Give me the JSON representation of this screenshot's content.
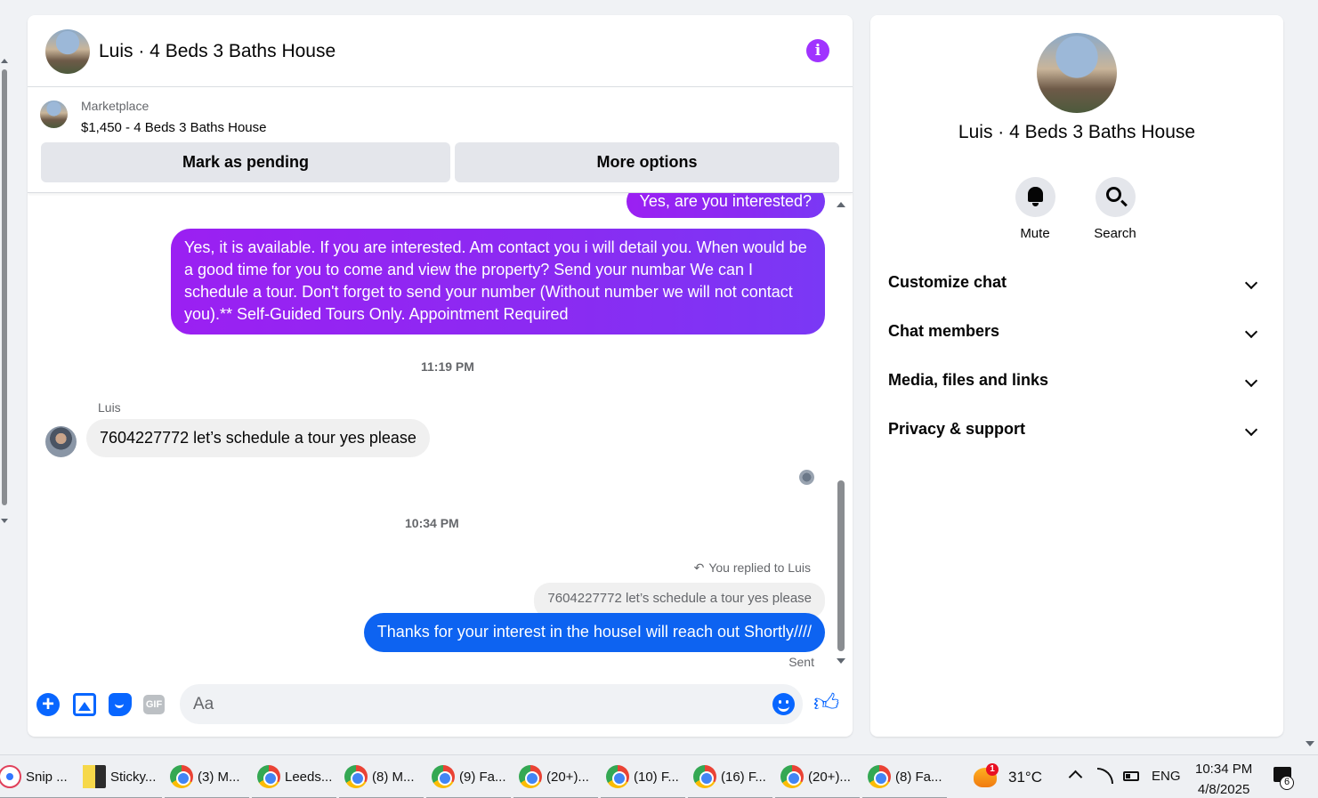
{
  "chat": {
    "title": "Luis · 4 Beds 3 Baths House",
    "marketplace_label": "Marketplace",
    "listing": "$1,450 - 4 Beds 3 Baths House",
    "mark_pending": "Mark as pending",
    "more_options": "More options"
  },
  "messages": {
    "m1": "Yes, are you interested?",
    "m2": "Yes, it is available. If you are interested.  Am contact you i will detail you.  When would be a good time for you to come and view the property? Send your numbar We can I schedule a tour.  Don't forget to send your number (Without number we will not contact you).** Self-Guided Tours Only. Appointment Required",
    "time1": "11:19 PM",
    "sender": "Luis",
    "m3": "7604227772 let’s schedule a tour yes please",
    "time2": "10:34 PM",
    "replied": "You replied to Luis",
    "quote": "7604227772 let’s schedule a tour yes please",
    "m4": "Thanks for your interest in the houseI will reach out Shortly////",
    "status": "Sent"
  },
  "composer": {
    "placeholder": "Aa",
    "gif_label": "GIF"
  },
  "info_panel": {
    "name": "Luis · 4 Beds 3 Baths House",
    "mute": "Mute",
    "search": "Search",
    "sections": [
      "Customize chat",
      "Chat members",
      "Media, files and links",
      "Privacy & support"
    ]
  },
  "taskbar": {
    "apps": [
      "Snip ...",
      "Sticky...",
      "(3) M...",
      "Leeds...",
      "(8) M...",
      "(9) Fa...",
      "(20+)...",
      "(10) F...",
      "(16) F...",
      "(20+)...",
      "(8) Fa..."
    ],
    "weather_badge": "1",
    "temperature": "31°C",
    "language": "ENG",
    "time": "10:34 PM",
    "date": "4/8/2025",
    "notifications": "6"
  },
  "icons": {
    "info": "info-icon",
    "like": "thumbs-up-icon",
    "emoji": "emoji-icon",
    "add": "plus-icon",
    "photo": "photo-icon",
    "sticker": "sticker-icon",
    "gif": "gif-icon"
  },
  "colors": {
    "accent_purple": "#a033ff",
    "outgoing_blue": "#0d63f1",
    "messenger_blue": "#0866ff"
  }
}
